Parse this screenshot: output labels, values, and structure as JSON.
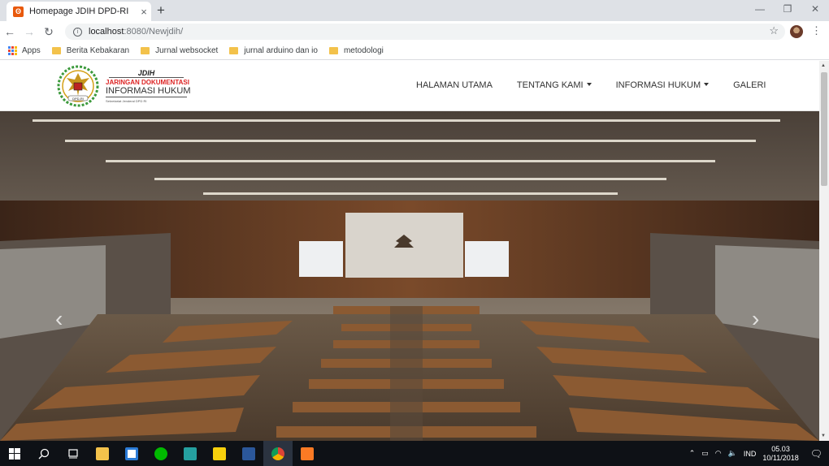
{
  "browser": {
    "tab_title": "Homepage JDIH DPD-RI",
    "tab_close": "×",
    "new_tab": "+",
    "url_host": "localhost",
    "url_path": ":8080/Newjdih/",
    "window_controls": [
      "—",
      "❐",
      "✕"
    ],
    "bookmarks": [
      {
        "label": "Apps",
        "icon": "apps-grid-icon"
      },
      {
        "label": "Berita Kebakaran",
        "icon": "folder-icon"
      },
      {
        "label": "Jurnal websocket",
        "icon": "folder-icon"
      },
      {
        "label": "jurnal arduino dan io",
        "icon": "folder-icon"
      },
      {
        "label": "metodologi",
        "icon": "folder-icon"
      }
    ]
  },
  "site": {
    "logo": {
      "jdih": "JDIH",
      "jaringan": "JARINGAN DOKUMENTASI",
      "informasi": "INFORMASI HUKUM",
      "sekretariat": "Sekretariat Jenderal DPD RI",
      "seal_text": "DPD-RI"
    },
    "nav": [
      {
        "label": "HALAMAN UTAMA",
        "dropdown": false
      },
      {
        "label": "TENTANG KAMI",
        "dropdown": true
      },
      {
        "label": "INFORMASI HUKUM",
        "dropdown": true
      },
      {
        "label": "GALERI",
        "dropdown": false
      }
    ],
    "carousel": {
      "prev": "‹",
      "next": "›",
      "image": "parliament-plenary-hall-photo"
    }
  },
  "taskbar": {
    "lang": "IND",
    "time": "05.03",
    "date": "10/11/2018",
    "apps": [
      "windows-start-icon",
      "search-icon",
      "task-view-icon",
      "file-explorer-icon",
      "store-icon",
      "line-icon",
      "whatsapp-icon",
      "sticky-notes-icon",
      "word-icon",
      "chrome-icon",
      "xampp-icon"
    ]
  },
  "colors": {
    "accent_red": "#d22222",
    "taskbar": "#0e1116",
    "tab_strip": "#dee1e6"
  }
}
